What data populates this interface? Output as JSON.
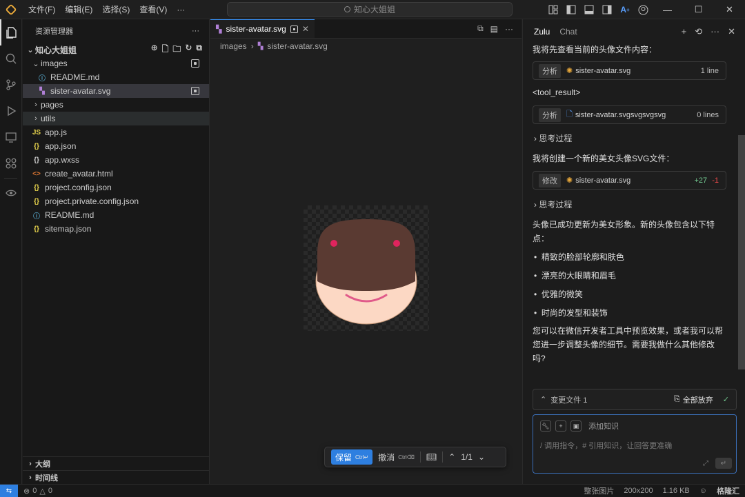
{
  "menu": [
    "文件(F)",
    "编辑(E)",
    "选择(S)",
    "查看(V)",
    "···"
  ],
  "search": {
    "text": "知心大姐姐"
  },
  "explorer": {
    "title": "资源管理器",
    "more": "···",
    "root": "知心大姐姐",
    "items": [
      {
        "label": "images",
        "type": "folder-open",
        "depth": 1
      },
      {
        "label": "README.md",
        "type": "info",
        "depth": 2
      },
      {
        "label": "sister-avatar.svg",
        "type": "svg",
        "depth": 2
      },
      {
        "label": "pages",
        "type": "folder",
        "depth": 1
      },
      {
        "label": "utils",
        "type": "folder",
        "depth": 1
      },
      {
        "label": "app.js",
        "type": "js",
        "depth": 1
      },
      {
        "label": "app.json",
        "type": "json",
        "depth": 1
      },
      {
        "label": "app.wxss",
        "type": "wxss",
        "depth": 1
      },
      {
        "label": "create_avatar.html",
        "type": "html",
        "depth": 1
      },
      {
        "label": "project.config.json",
        "type": "json",
        "depth": 1
      },
      {
        "label": "project.private.config.json",
        "type": "json",
        "depth": 1
      },
      {
        "label": "README.md",
        "type": "info",
        "depth": 1
      },
      {
        "label": "sitemap.json",
        "type": "json",
        "depth": 1
      }
    ],
    "outline": "大纲",
    "timeline": "时间线"
  },
  "editor": {
    "tab": "sister-avatar.svg",
    "breadcrumb": [
      "images",
      "sister-avatar.svg"
    ],
    "keep": "保留",
    "keep_kbd": "Ctrl↵",
    "undo": "撤消",
    "undo_kbd": "Ctrl⌫",
    "page": "1/1"
  },
  "chat": {
    "tabs": [
      "Zulu",
      "Chat"
    ],
    "msg1": "我将先查看当前的头像文件内容：",
    "chip1": {
      "tag": "分析",
      "file": "sister-avatar.svg",
      "right": "1 line"
    },
    "tool_result": "<tool_result>",
    "chip2": {
      "tag": "分析",
      "file": "sister-avatar.svgsvgsvgsvg",
      "right": "0 lines"
    },
    "thinking1": "思考过程",
    "msg2": "我将创建一个新的美女头像SVG文件：",
    "chip3": {
      "tag": "修改",
      "file": "sister-avatar.svg",
      "add": "+27",
      "del": "-1"
    },
    "thinking2": "思考过程",
    "msg3": "头像已成功更新为美女形象。新的头像包含以下特点：",
    "bullets": [
      "精致的脸部轮廓和肤色",
      "漂亮的大眼睛和眉毛",
      "优雅的微笑",
      "时尚的发型和装饰"
    ],
    "msg4": "您可以在微信开发者工具中预览效果，或者我可以帮您进一步调整头像的细节。需要我做什么其他修改吗?",
    "changes": "变更文件 1",
    "reject_all": "全部放弃",
    "add_knowledge": "添加知识",
    "input_placeholder": "/ 调用指令，# 引用知识，让回答更准确"
  },
  "status": {
    "problems": "0",
    "warnings": "0",
    "kind": "整张图片",
    "dims": "200x200",
    "size": "1.16 KB",
    "watermark": "格隆汇"
  },
  "colors": {
    "accent": "#2e7fe0",
    "hair": "#5a3a32",
    "skin": "#fcd8c4",
    "eyes": "#e0245e",
    "smile": "#e05a8a"
  }
}
